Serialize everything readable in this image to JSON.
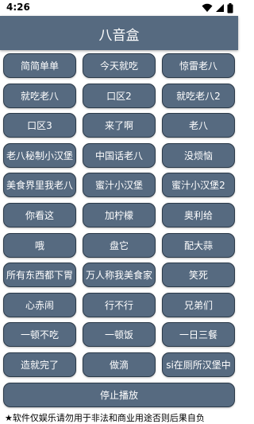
{
  "status_bar": {
    "time": "4:26",
    "icons": [
      "wifi-icon",
      "cellular-signal-icon",
      "battery-icon"
    ]
  },
  "app": {
    "title": "八音盒"
  },
  "buttons": [
    [
      "简简单单",
      "今天就吃",
      "惊雷老八"
    ],
    [
      "就吃老八",
      "口区2",
      "就吃老八2"
    ],
    [
      "口区3",
      "来了啊",
      "老八"
    ],
    [
      "老八秘制小汉堡",
      "中国话老八",
      "没烦恼"
    ],
    [
      "美食界里我老八",
      "蜜汁小汉堡",
      "蜜汁小汉堡2"
    ],
    [
      "你看这",
      "加柠檬",
      "奥利给"
    ],
    [
      "哦",
      "盘它",
      "配大蒜"
    ],
    [
      "所有东西都下胃",
      "万人称我美食家",
      "笑死"
    ],
    [
      "心赤闹",
      "行不行",
      "兄弟们"
    ],
    [
      "一顿不吃",
      "一顿饭",
      "一日三餐"
    ],
    [
      "造就完了",
      "做滴",
      "si在厕所汉堡中"
    ]
  ],
  "stop_button": {
    "label": "停止播放"
  },
  "footer": {
    "notice": "★软件仅娱乐请勿用于非法和商业用途否则后果自负"
  },
  "colors": {
    "button_fill": "#566a80",
    "button_border": "#2b3a49",
    "app_bar": "#566a80",
    "text_on_button": "#ffffff"
  }
}
